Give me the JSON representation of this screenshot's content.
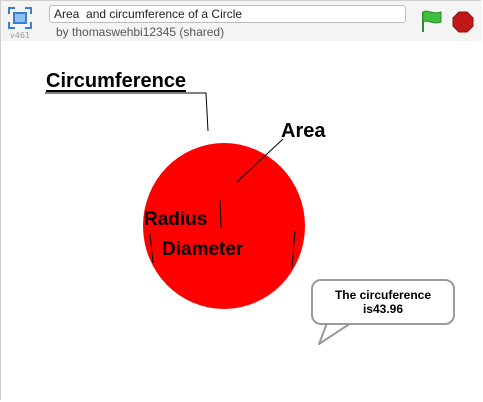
{
  "project": {
    "title": "Area  and circumference of a Circle",
    "author_line": "by thomaswehbi12345 (shared)",
    "version": "v461"
  },
  "controls": {
    "fullscreen_icon": "fullscreen-icon",
    "flag_icon": "green-flag-icon",
    "stop_icon": "stop-sign-icon",
    "flag_color": "#3fbf3f",
    "stop_color": "#c01818"
  },
  "stage": {
    "circle_color": "#ff0000",
    "labels": {
      "circumference": "Circumference",
      "area": "Area",
      "radius": "Radius",
      "diameter": "Diameter"
    },
    "speech_bubble": {
      "line1": "The circuference",
      "line2": "is43.96"
    }
  }
}
